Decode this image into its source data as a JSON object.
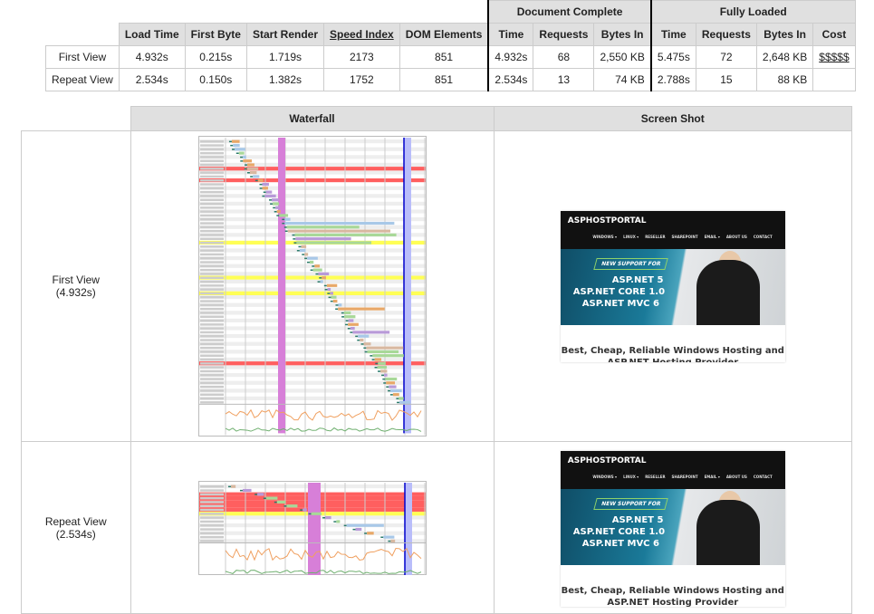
{
  "summary": {
    "group_headers": [
      "Document Complete",
      "Fully Loaded"
    ],
    "columns": [
      "Load Time",
      "First Byte",
      "Start Render",
      "Speed Index",
      "DOM Elements",
      "Time",
      "Requests",
      "Bytes In",
      "Time",
      "Requests",
      "Bytes In",
      "Cost"
    ],
    "rows": [
      {
        "label": "First View",
        "cells": [
          "4.932s",
          "0.215s",
          "1.719s",
          "2173",
          "851",
          "4.932s",
          "68",
          "2,550 KB",
          "5.475s",
          "72",
          "2,648 KB",
          "$$$$$"
        ]
      },
      {
        "label": "Repeat View",
        "cells": [
          "2.534s",
          "0.150s",
          "1.382s",
          "1752",
          "851",
          "2.534s",
          "13",
          "74 KB",
          "2.788s",
          "15",
          "88 KB",
          ""
        ]
      }
    ]
  },
  "details": {
    "headers": [
      "Waterfall",
      "Screen Shot"
    ],
    "rows": [
      {
        "label": "First View",
        "time": "(4.932s)"
      },
      {
        "label": "Repeat View",
        "time": "(2.534s)"
      }
    ]
  },
  "screenshot": {
    "logo": "ASPHOSTPORTAL",
    "nav": [
      "WINDOWS ▾",
      "LINUX ▾",
      "RESELLER",
      "SHAREPOINT",
      "EMAIL ▾",
      "ABOUT US",
      "CONTACT"
    ],
    "badge": "NEW SUPPORT FOR",
    "lines": [
      "ASP.NET 5",
      "ASP.NET CORE 1.0",
      "ASP.NET MVC 6"
    ],
    "tagline": "Best, Cheap, Reliable Windows Hosting and ASP.NET Hosting Provider"
  },
  "colors": {
    "start_render": "#d77fd8",
    "doc_complete": "#0000cc",
    "fully_loaded": "#b9bdfa",
    "error_row": "#ff5f5f",
    "warning_row": "#ffff55"
  }
}
